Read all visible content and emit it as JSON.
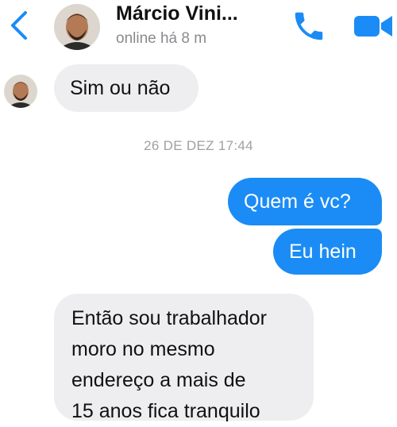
{
  "header": {
    "contact_name": "Márcio Vini...",
    "presence": "online há 8 m"
  },
  "date_separator": "26 DE DEZ 17:44",
  "messages": [
    {
      "direction": "in",
      "text": "Sim ou não"
    },
    {
      "direction": "out",
      "text": "Quem é vc?"
    },
    {
      "direction": "out",
      "text": "Eu hein"
    },
    {
      "direction": "in",
      "lines": [
        "Então sou trabalhador",
        "moro no mesmo",
        "endereço a mais de",
        "15 anos fica tranquilo"
      ]
    }
  ],
  "icons": {
    "back": "chevron-left-icon",
    "call": "phone-icon",
    "video": "video-camera-icon"
  },
  "colors": {
    "accent": "#1b8cf5",
    "incoming_bubble": "#eeeef0",
    "secondary_text": "#8a8a8f"
  }
}
